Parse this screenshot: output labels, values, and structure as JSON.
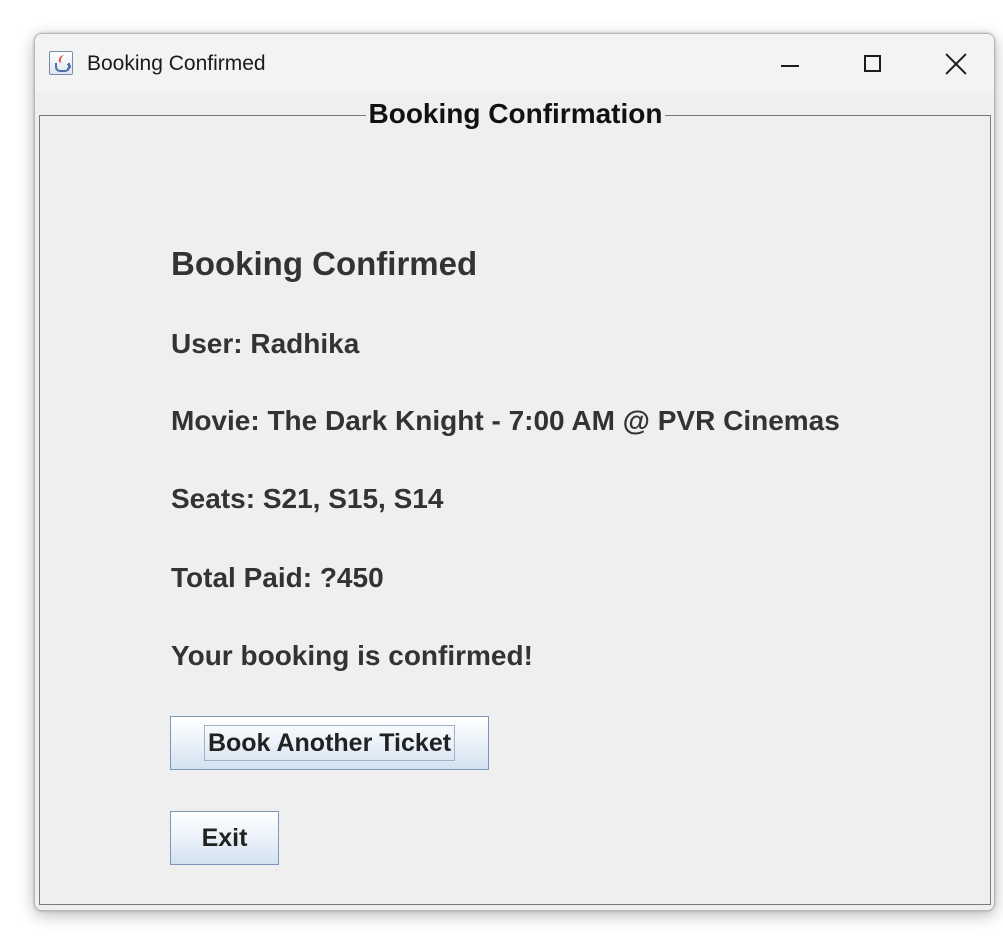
{
  "window": {
    "title": "Booking Confirmed",
    "icon": "java-cup-icon",
    "controls": {
      "minimize": "minimize-icon",
      "maximize": "maximize-icon",
      "close": "close-icon"
    }
  },
  "panel": {
    "title": "Booking Confirmation"
  },
  "booking": {
    "heading": "Booking Confirmed",
    "user": "User: Radhika",
    "movie": "Movie: The Dark Knight - 7:00 AM @ PVR Cinemas",
    "seats": "Seats: S21, S15, S14",
    "total": "Total Paid: ?450",
    "message": "Your booking is confirmed!"
  },
  "buttons": {
    "book_another": "Book Another Ticket",
    "exit": "Exit"
  },
  "colors": {
    "window_bg": "#f0f0f0",
    "label_text": "#333333",
    "button_border": "#7d97b8"
  }
}
